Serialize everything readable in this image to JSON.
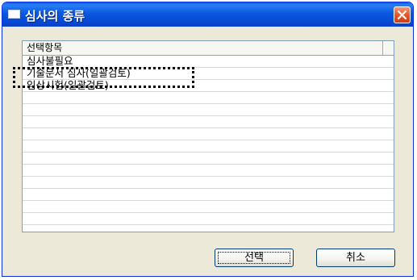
{
  "window": {
    "title": "심사의 종류"
  },
  "list": {
    "column_header": "선택항목",
    "items": [
      "심사불필요",
      "기술문서 심사(일괄검토)",
      "임상시험(일괄검토)"
    ],
    "selected_index": 1
  },
  "buttons": {
    "select_label": "선택",
    "cancel_label": "취소"
  },
  "colors": {
    "titlebar": "#0a58e0",
    "close_button": "#e1582e",
    "dialog_face": "#ece9d8",
    "list_border": "#7f9db9"
  }
}
